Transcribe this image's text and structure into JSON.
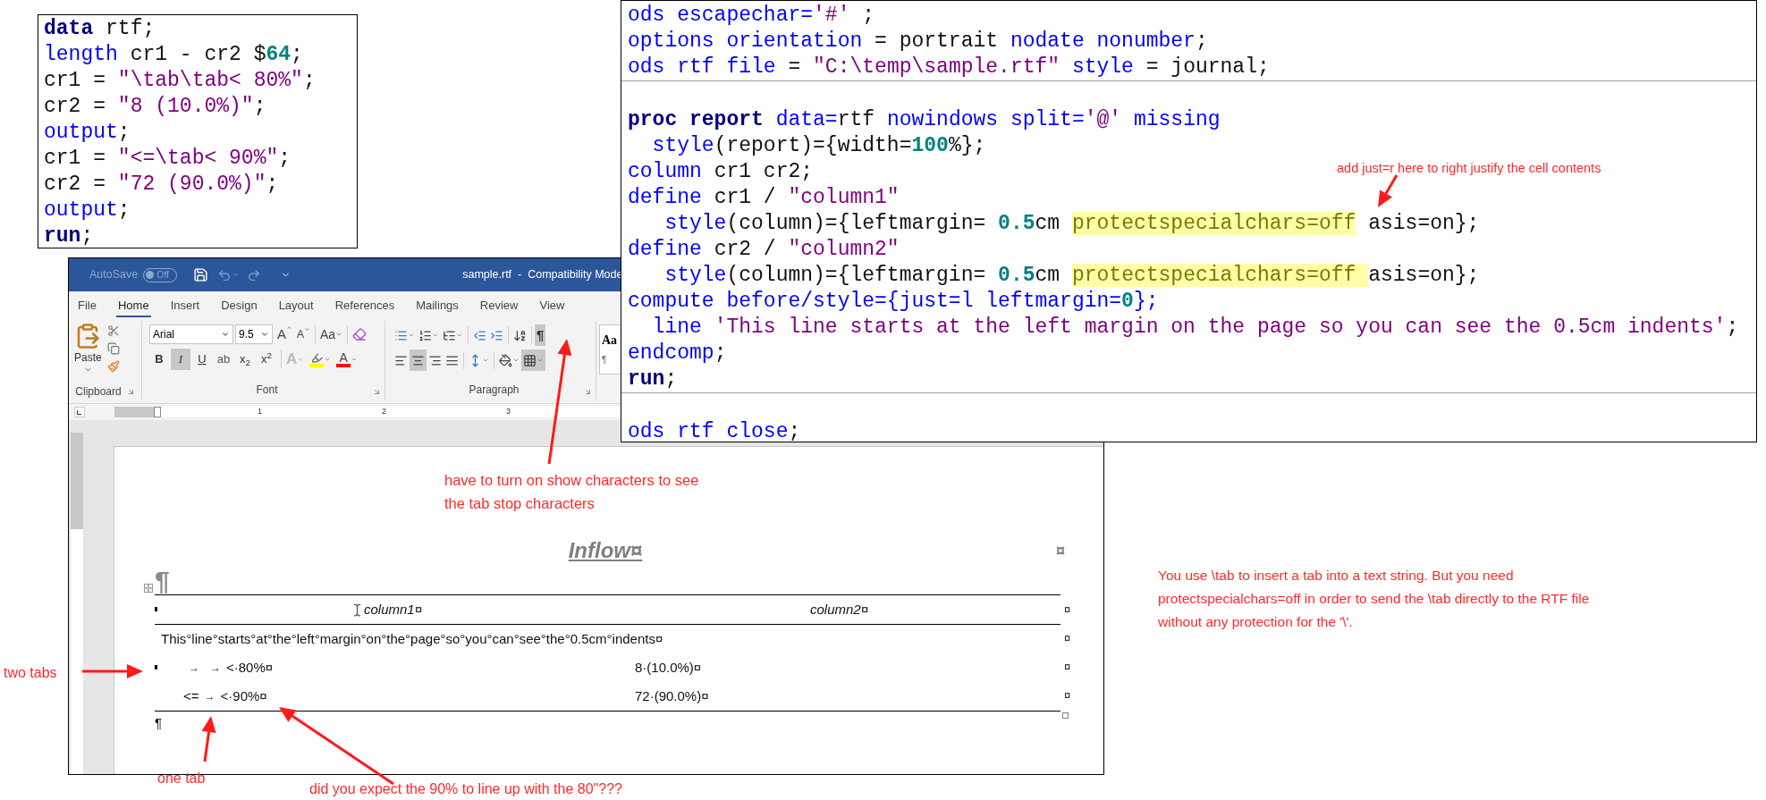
{
  "code_snippet": {
    "lines": [
      {
        "tokens": [
          {
            "kind": "bold_keyword",
            "text": "data"
          },
          {
            "kind": "plain",
            "text": " rtf;"
          }
        ]
      },
      {
        "tokens": [
          {
            "kind": "keyword",
            "text": "length"
          },
          {
            "kind": "plain",
            "text": " cr1 - cr2 $"
          },
          {
            "kind": "number",
            "text": "64"
          },
          {
            "kind": "plain",
            "text": ";"
          }
        ]
      },
      {
        "tokens": [
          {
            "kind": "plain",
            "text": "cr1 = "
          },
          {
            "kind": "string",
            "text": "\"\\tab\\tab< 80%\""
          },
          {
            "kind": "plain",
            "text": ";"
          }
        ]
      },
      {
        "tokens": [
          {
            "kind": "plain",
            "text": "cr2 = "
          },
          {
            "kind": "string",
            "text": "\"8 (10.0%)\""
          },
          {
            "kind": "plain",
            "text": ";"
          }
        ]
      },
      {
        "tokens": [
          {
            "kind": "keyword",
            "text": "output"
          },
          {
            "kind": "plain",
            "text": ";"
          }
        ]
      },
      {
        "tokens": [
          {
            "kind": "plain",
            "text": "cr1 = "
          },
          {
            "kind": "string",
            "text": "\"<=\\tab< 90%\""
          },
          {
            "kind": "plain",
            "text": ";"
          }
        ]
      },
      {
        "tokens": [
          {
            "kind": "plain",
            "text": "cr2 = "
          },
          {
            "kind": "string",
            "text": "\"72 (90.0%)\""
          },
          {
            "kind": "plain",
            "text": ";"
          }
        ]
      },
      {
        "tokens": [
          {
            "kind": "keyword",
            "text": "output"
          },
          {
            "kind": "plain",
            "text": ";"
          }
        ]
      },
      {
        "tokens": [
          {
            "kind": "bold_keyword",
            "text": "run"
          },
          {
            "kind": "plain",
            "text": ";"
          }
        ]
      }
    ]
  },
  "code_editor": {
    "sections": [
      {
        "lines": [
          {
            "tokens": [
              {
                "kind": "keyword",
                "text": "ods escapechar="
              },
              {
                "kind": "string",
                "text": "'#'"
              },
              {
                "kind": "plain",
                "text": " ;"
              }
            ]
          },
          {
            "tokens": [
              {
                "kind": "keyword",
                "text": "options orientation"
              },
              {
                "kind": "plain",
                "text": " = portrait "
              },
              {
                "kind": "keyword",
                "text": "nodate nonumber"
              },
              {
                "kind": "plain",
                "text": ";"
              }
            ]
          },
          {
            "tokens": [
              {
                "kind": "keyword",
                "text": "ods rtf file"
              },
              {
                "kind": "plain",
                "text": " = "
              },
              {
                "kind": "string",
                "text": "\"C:\\temp\\sample.rtf\""
              },
              {
                "kind": "keyword",
                "text": " style"
              },
              {
                "kind": "plain",
                "text": " = journal;"
              }
            ]
          }
        ]
      },
      {
        "lines": [
          {
            "tokens": [
              {
                "kind": "bold_keyword",
                "text": "proc report"
              },
              {
                "kind": "keyword",
                "text": " data="
              },
              {
                "kind": "plain",
                "text": "rtf"
              },
              {
                "kind": "keyword",
                "text": " nowindows split="
              },
              {
                "kind": "string",
                "text": "'@'"
              },
              {
                "kind": "keyword",
                "text": " missing"
              }
            ]
          },
          {
            "tokens": [
              {
                "kind": "keyword",
                "text": "  style"
              },
              {
                "kind": "plain",
                "text": "(report)={width="
              },
              {
                "kind": "number",
                "text": "100"
              },
              {
                "kind": "plain",
                "text": "%};"
              }
            ]
          },
          {
            "tokens": [
              {
                "kind": "keyword",
                "text": "column"
              },
              {
                "kind": "plain",
                "text": " cr1 cr2;"
              }
            ]
          },
          {
            "tokens": [
              {
                "kind": "keyword",
                "text": "define"
              },
              {
                "kind": "plain",
                "text": " cr1 / "
              },
              {
                "kind": "string",
                "text": "\"column1\""
              }
            ]
          },
          {
            "tokens": [
              {
                "kind": "keyword",
                "text": "   style"
              },
              {
                "kind": "plain",
                "text": "(column)={leftmargin= "
              },
              {
                "kind": "number",
                "text": "0.5"
              },
              {
                "kind": "plain",
                "text": "cm "
              },
              {
                "kind": "highlight",
                "text": "protectspecialchars=off"
              },
              {
                "kind": "plain",
                "text": " asis=on};"
              }
            ]
          },
          {
            "tokens": [
              {
                "kind": "keyword",
                "text": "define"
              },
              {
                "kind": "plain",
                "text": " cr2 / "
              },
              {
                "kind": "string",
                "text": "\"column2\""
              }
            ]
          },
          {
            "tokens": [
              {
                "kind": "keyword",
                "text": "   style"
              },
              {
                "kind": "plain",
                "text": "(column)={leftmargin= "
              },
              {
                "kind": "number",
                "text": "0.5"
              },
              {
                "kind": "plain",
                "text": "cm "
              },
              {
                "kind": "highlight",
                "text": "protectspecialchars=off "
              },
              {
                "kind": "plain",
                "text": "asis=on};"
              }
            ]
          },
          {
            "tokens": [
              {
                "kind": "keyword",
                "text": "compute before/style={just=l leftmargin="
              },
              {
                "kind": "number",
                "text": "0"
              },
              {
                "kind": "keyword",
                "text": "};"
              }
            ]
          },
          {
            "tokens": [
              {
                "kind": "keyword",
                "text": "  line "
              },
              {
                "kind": "string",
                "text": "'This line starts at the left margin on the page so you can see the 0.5cm indents'"
              },
              {
                "kind": "plain",
                "text": ";"
              }
            ]
          },
          {
            "tokens": [
              {
                "kind": "keyword",
                "text": "endcomp"
              },
              {
                "kind": "plain",
                "text": ";"
              }
            ]
          },
          {
            "tokens": [
              {
                "kind": "bold_keyword",
                "text": "run"
              },
              {
                "kind": "plain",
                "text": ";"
              }
            ]
          }
        ]
      },
      {
        "lines": [
          {
            "tokens": [
              {
                "kind": "keyword",
                "text": "ods rtf close"
              },
              {
                "kind": "plain",
                "text": ";"
              }
            ]
          }
        ]
      }
    ]
  },
  "word_window": {
    "title_bar": {
      "autosave_label": "AutoSave",
      "autosave_on": false,
      "autosave_state": "Off",
      "title": "sample.rtf  -  Compatibility Mode"
    },
    "tabs": [
      {
        "label": "File",
        "selected": false
      },
      {
        "label": "Home",
        "selected": true
      },
      {
        "label": "Insert",
        "selected": false
      },
      {
        "label": "Design",
        "selected": false
      },
      {
        "label": "Layout",
        "selected": false
      },
      {
        "label": "References",
        "selected": false
      },
      {
        "label": "Mailings",
        "selected": false
      },
      {
        "label": "Review",
        "selected": false
      },
      {
        "label": "View",
        "selected": false
      }
    ],
    "ribbon": {
      "clipboard": {
        "label": "Clipboard",
        "paste_label": "Paste"
      },
      "font": {
        "label": "Font",
        "font_name": "Arial",
        "font_size": "9.5",
        "size_buttons": [
          {
            "kind": "grow",
            "label": "A"
          },
          {
            "kind": "shrink",
            "label": "A"
          }
        ],
        "change_case": "Aa",
        "buttons": [
          {
            "kind": "bold",
            "label": "B",
            "on": false
          },
          {
            "kind": "italic",
            "label": "I",
            "on": true
          },
          {
            "kind": "underline",
            "label": "U",
            "on": false
          },
          {
            "kind": "strikethrough",
            "label": "ab",
            "on": false
          },
          {
            "kind": "subscript",
            "label": "x$_{2}$",
            "on": false
          },
          {
            "kind": "superscript",
            "label": "x$^{2}$",
            "on": false
          }
        ],
        "color_buttons": [
          {
            "kind": "effects",
            "label": "A"
          },
          {
            "kind": "highlight",
            "color": "#ffff00"
          },
          {
            "kind": "font_color",
            "label": "A",
            "color": "#ff0000"
          }
        ]
      },
      "paragraph": {
        "label": "Paragraph",
        "rows": [
          [
            [
              {
                "kind": "bullets",
                "on": false
              },
              {
                "kind": "numbering",
                "on": false
              },
              {
                "kind": "multilevel",
                "on": false
              }
            ],
            [
              {
                "kind": "outdent",
                "on": false
              },
              {
                "kind": "indent",
                "on": false
              }
            ],
            [
              {
                "kind": "sort",
                "on": false
              }
            ],
            [
              {
                "kind": "marks",
                "label": "¶",
                "on": true
              }
            ]
          ],
          [
            [
              {
                "kind": "align_left",
                "on": false
              },
              {
                "kind": "align_center",
                "on": true
              },
              {
                "kind": "align_right",
                "on": false
              },
              {
                "kind": "justify",
                "on": false
              }
            ],
            [
              {
                "kind": "line_spacing",
                "on": false
              }
            ],
            [
              {
                "kind": "shading",
                "on": false
              },
              {
                "kind": "borders",
                "on": true
              }
            ]
          ]
        ]
      },
      "styles": {
        "sample": "Aa",
        "name": "¶"
      }
    },
    "ruler": {
      "marks": [
        "1",
        "2",
        "3"
      ]
    },
    "document": {
      "heading": "Inflow¤",
      "heading_end": "¤",
      "pilcrow": "¶",
      "table": {
        "header": {
          "marker": true,
          "cells": [
            "column1¤",
            "column2¤"
          ],
          "end": "¤"
        },
        "line_row": {
          "text": "This°line°starts°at°the°left°margin°on°the°page°so°you°can°see°the°0.5cm°indents¤",
          "end": "¤"
        },
        "rows": [
          {
            "marker": true,
            "segments": [
              {
                "kind": "tab",
                "text": "→"
              },
              {
                "kind": "tab",
                "text": "→"
              },
              {
                "kind": "text",
                "text": "<·80%¤"
              }
            ],
            "value": "8·(10.0%)¤",
            "end": "¤"
          },
          {
            "marker": false,
            "segments": [
              {
                "kind": "text",
                "text": "<="
              },
              {
                "kind": "tab",
                "text": "→"
              },
              {
                "kind": "text",
                "text": "<·90%¤"
              }
            ],
            "value": "72·(90.0%)¤",
            "end": "¤"
          }
        ]
      },
      "end_pilcrow": "¶"
    }
  },
  "annotations": {
    "show_marks_note": [
      "have to turn on show characters to see",
      "the tab stop characters"
    ],
    "justify_note": "add just=r here to right justify the cell contents",
    "two_tabs": "two tabs",
    "one_tab": "one tab",
    "alignment_question": "did you expect the 90% to line up with the 80\"???",
    "explanation": [
      "You use \\tab to insert a tab into a text string. But you need",
      "protectspecialchars=off in order to send the \\tab directly to the RTF file",
      "without any protection for the '\\'."
    ]
  }
}
